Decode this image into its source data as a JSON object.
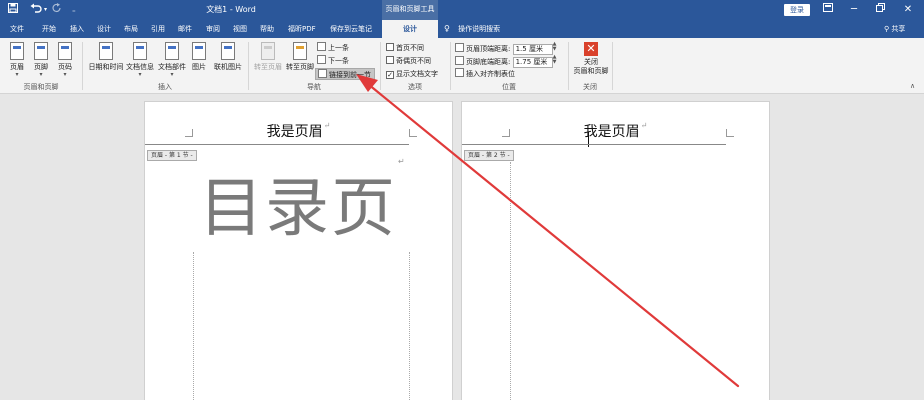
{
  "titlebar": {
    "save_icon": "save-icon",
    "undo_icon": "undo-icon",
    "redo_icon": "redo-icon",
    "customize_icon": "customize-icon",
    "doc_title": "文档1 - Word",
    "contextual_title": "页眉和页脚工具",
    "login_label": "登录",
    "ribbon_display_icon": "ribbon-display-icon",
    "minimize_icon": "minimize-icon",
    "restore_icon": "restore-icon",
    "close_icon": "close-icon"
  },
  "tabs": [
    {
      "label": "文件"
    },
    {
      "label": "开始"
    },
    {
      "label": "插入"
    },
    {
      "label": "设计"
    },
    {
      "label": "布局"
    },
    {
      "label": "引用"
    },
    {
      "label": "邮件"
    },
    {
      "label": "审阅"
    },
    {
      "label": "视图"
    },
    {
      "label": "帮助"
    },
    {
      "label": "福昕PDF"
    },
    {
      "label": "保存到云笔记"
    },
    {
      "label": "设计"
    }
  ],
  "search": {
    "label": "操作说明搜索",
    "icon": "lightbulb-icon"
  },
  "share": {
    "label": "共享",
    "icon": "person-icon"
  },
  "ribbon": {
    "header_footer_group": {
      "label": "页眉和页脚",
      "header": "页眉",
      "footer": "页脚",
      "page_number": "页码"
    },
    "insert_group": {
      "label": "插入",
      "date_time": "日期和时间",
      "doc_info": "文档信息",
      "doc_parts": "文档部件",
      "picture": "图片",
      "online_picture": "联机图片"
    },
    "navigation_group": {
      "label": "导航",
      "goto_header": "转至页眉",
      "goto_footer": "转至页脚",
      "previous": "上一条",
      "next": "下一条",
      "link_to_previous": "链接到前一节"
    },
    "options_group": {
      "label": "选项",
      "different_first": "首页不同",
      "different_odd_even": "奇偶页不同",
      "show_doc_text": "显示文档文字",
      "show_doc_text_checked": "✓"
    },
    "position_group": {
      "label": "位置",
      "header_top_label": "页眉顶端距离:",
      "header_top_value": "1.5 厘米",
      "footer_bottom_label": "页脚底端距离:",
      "footer_bottom_value": "1.75 厘米",
      "insert_align_tab": "插入对齐制表位"
    },
    "close_group": {
      "label": "关闭",
      "close_label_line1": "关闭",
      "close_label_line2": "页眉和页脚",
      "close_glyph": "✕"
    },
    "collapse_glyph": "∧"
  },
  "pages": [
    {
      "header_text": "我是页眉",
      "section_label": "页眉 - 第 1 节 -",
      "body_title": "目录页"
    },
    {
      "header_text": "我是页眉",
      "section_label": "页眉 - 第 2 节 -"
    }
  ],
  "para_mark": "↵",
  "colors": {
    "titlebar": "#2b579a",
    "ribbon": "#f3f3f3",
    "arrow": "#e03a3a",
    "close_button": "#d9412b"
  }
}
